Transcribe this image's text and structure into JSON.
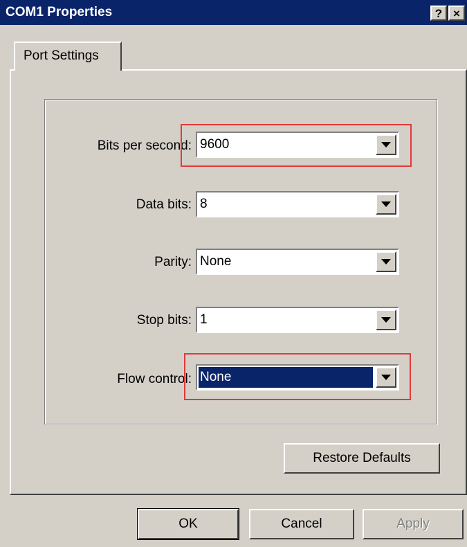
{
  "window": {
    "title": "COM1 Properties",
    "help_button": "?",
    "close_button": "×"
  },
  "tabs": [
    {
      "label": "Port Settings",
      "active": true
    }
  ],
  "fields": [
    {
      "label": "Bits per second:",
      "value": "9600",
      "highlighted": true,
      "selected": false
    },
    {
      "label": "Data bits:",
      "value": "8",
      "highlighted": false,
      "selected": false
    },
    {
      "label": "Parity:",
      "value": "None",
      "highlighted": false,
      "selected": false
    },
    {
      "label": "Stop bits:",
      "value": "1",
      "highlighted": false,
      "selected": false
    },
    {
      "label": "Flow control:",
      "value": "None",
      "highlighted": true,
      "selected": true
    }
  ],
  "buttons": {
    "restore_defaults": "Restore Defaults",
    "ok": "OK",
    "cancel": "Cancel",
    "apply": "Apply"
  },
  "colors": {
    "titlebar": "#0a246a",
    "face": "#d4d0c8",
    "highlight_box": "#e03a3a",
    "selection": "#0a246a"
  }
}
